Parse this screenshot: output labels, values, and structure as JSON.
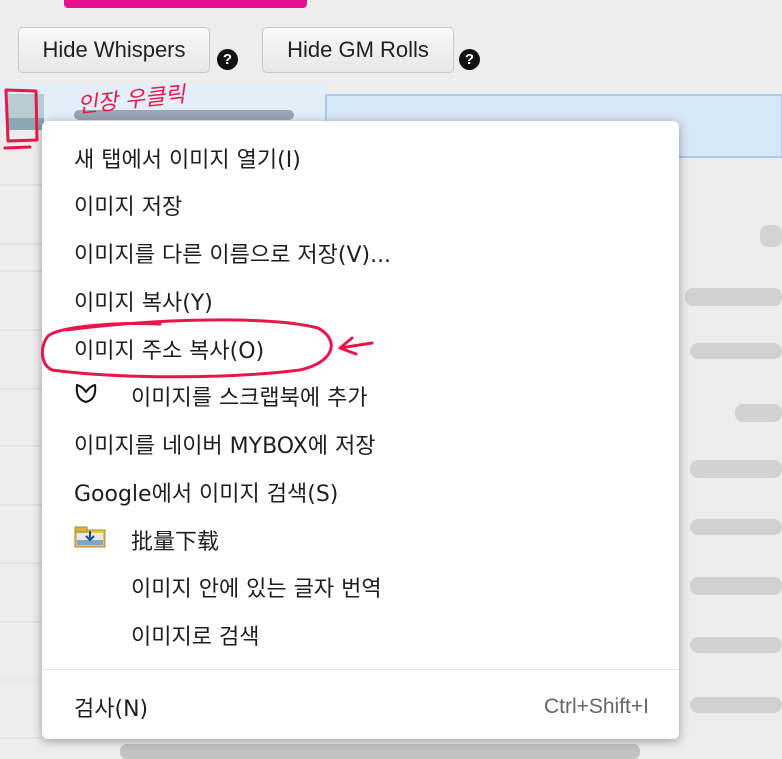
{
  "toolbar": {
    "hide_whispers_label": "Hide Whispers",
    "hide_gm_rolls_label": "Hide GM Rolls",
    "help_glyph": "?"
  },
  "annotation": {
    "handwritten_note": "인장 우클릭",
    "color": "#e8174a"
  },
  "context_menu": {
    "items": [
      {
        "label": "새 탭에서 이미지 열기(I)"
      },
      {
        "label": "이미지 저장"
      },
      {
        "label": "이미지를 다른 이름으로 저장(V)..."
      },
      {
        "label": "이미지 복사(Y)"
      },
      {
        "label": "이미지 주소 복사(O)",
        "highlighted_by_annotation": true
      },
      {
        "label": "이미지를 스크랩북에 추가",
        "icon": "scrapbook-leaf-icon"
      },
      {
        "label": "이미지를 네이버 MYBOX에 저장"
      },
      {
        "label": "Google에서 이미지 검색(S)"
      },
      {
        "label": "批量下载",
        "icon": "batch-download-folder-icon"
      },
      {
        "label": "이미지 안에 있는 글자 번역"
      },
      {
        "label": "이미지로 검색"
      }
    ],
    "inspect": {
      "label": "검사(N)",
      "shortcut": "Ctrl+Shift+I"
    }
  },
  "colors": {
    "accent_bar": "#e5118f",
    "annotation_red": "#e8174a",
    "help_icon": "#111111"
  }
}
